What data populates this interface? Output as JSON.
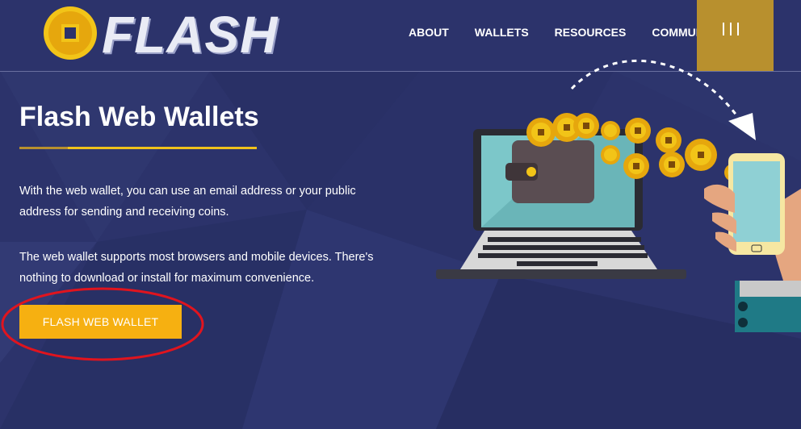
{
  "brand": {
    "name": "FLASH"
  },
  "nav": {
    "items": [
      {
        "label": "ABOUT"
      },
      {
        "label": "WALLETS"
      },
      {
        "label": "RESOURCES"
      },
      {
        "label": "COMMUNITY"
      }
    ]
  },
  "hero": {
    "title": "Flash Web Wallets",
    "paragraph1": "With the web wallet, you can use an email address or your public address for sending and receiving coins.",
    "paragraph2": "The web wallet supports most browsers and mobile devices. There's nothing to download or install for maximum convenience.",
    "cta_label": "FLASH WEB WALLET"
  },
  "colors": {
    "background": "#2c336b",
    "accent_gold": "#b8902e",
    "button_yellow": "#f6b011",
    "annotation_red": "#e0141e"
  },
  "icons": {
    "logo": "coin-logo-icon",
    "menu": "hamburger-menu-icon",
    "illustration": "laptop-wallet-to-phone-illustration"
  }
}
